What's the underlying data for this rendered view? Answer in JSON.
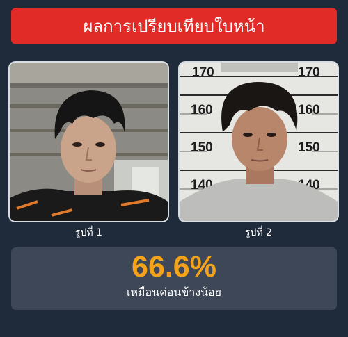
{
  "header": {
    "title": "ผลการเปรียบเทียบใบหน้า"
  },
  "photos": [
    {
      "caption": "รูปที่ 1"
    },
    {
      "caption": "รูปที่ 2"
    }
  ],
  "height_chart_labels": [
    "170",
    "160",
    "150",
    "140"
  ],
  "result": {
    "similarity": "66.6%",
    "verdict": "เหมือนค่อนข้างน้อย",
    "accent_color": "#f4a21a"
  },
  "colors": {
    "background": "#1f2a3b",
    "header": "#e02b27",
    "card": "#3d4758"
  }
}
